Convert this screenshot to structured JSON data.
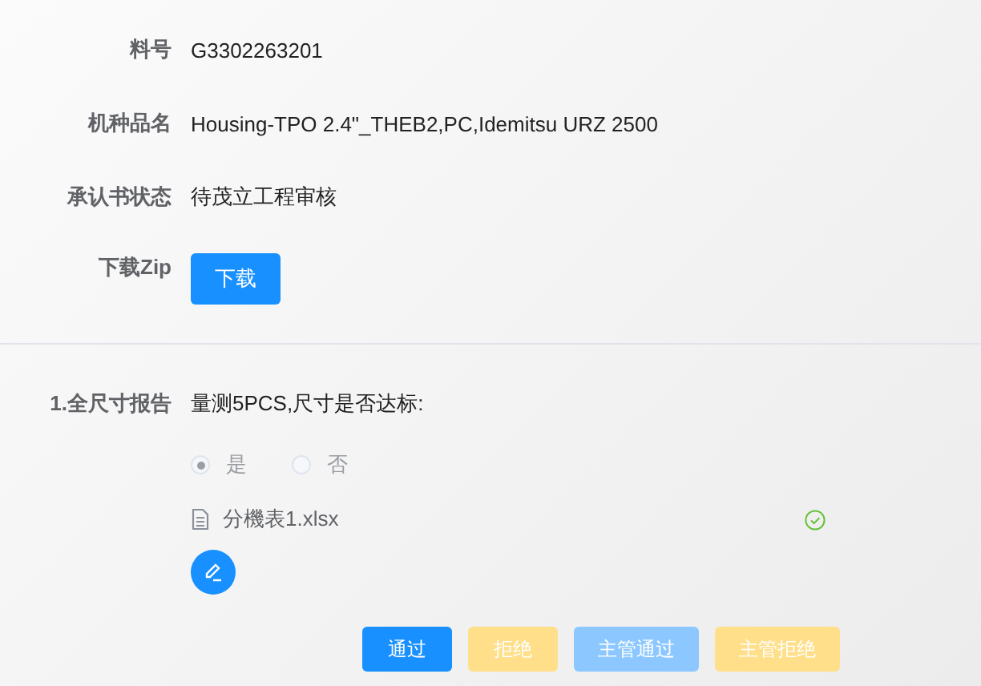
{
  "fields": [
    {
      "label": "料号",
      "value": "G3302263201"
    },
    {
      "label": "机种品名",
      "value": "Housing-TPO 2.4\"_THEB2,PC,Idemitsu URZ 2500"
    },
    {
      "label": "承认书状态",
      "value": "待茂立工程审核"
    }
  ],
  "download": {
    "label": "下载Zip",
    "button": "下载"
  },
  "report": {
    "label": "1.全尺寸报告",
    "question": "量测5PCS,尺寸是否达标:",
    "options": [
      {
        "label": "是",
        "selected": true,
        "disabled": true
      },
      {
        "label": "否",
        "selected": false,
        "disabled": true
      }
    ],
    "file": {
      "name": "分機表1.xlsx",
      "uploaded": true
    }
  },
  "actions": [
    {
      "label": "通过",
      "kind": "primary",
      "disabled": false
    },
    {
      "label": "拒绝",
      "kind": "warning",
      "disabled": true
    },
    {
      "label": "主管通过",
      "kind": "primary",
      "disabled": true
    },
    {
      "label": "主管拒绝",
      "kind": "warning",
      "disabled": true
    }
  ]
}
